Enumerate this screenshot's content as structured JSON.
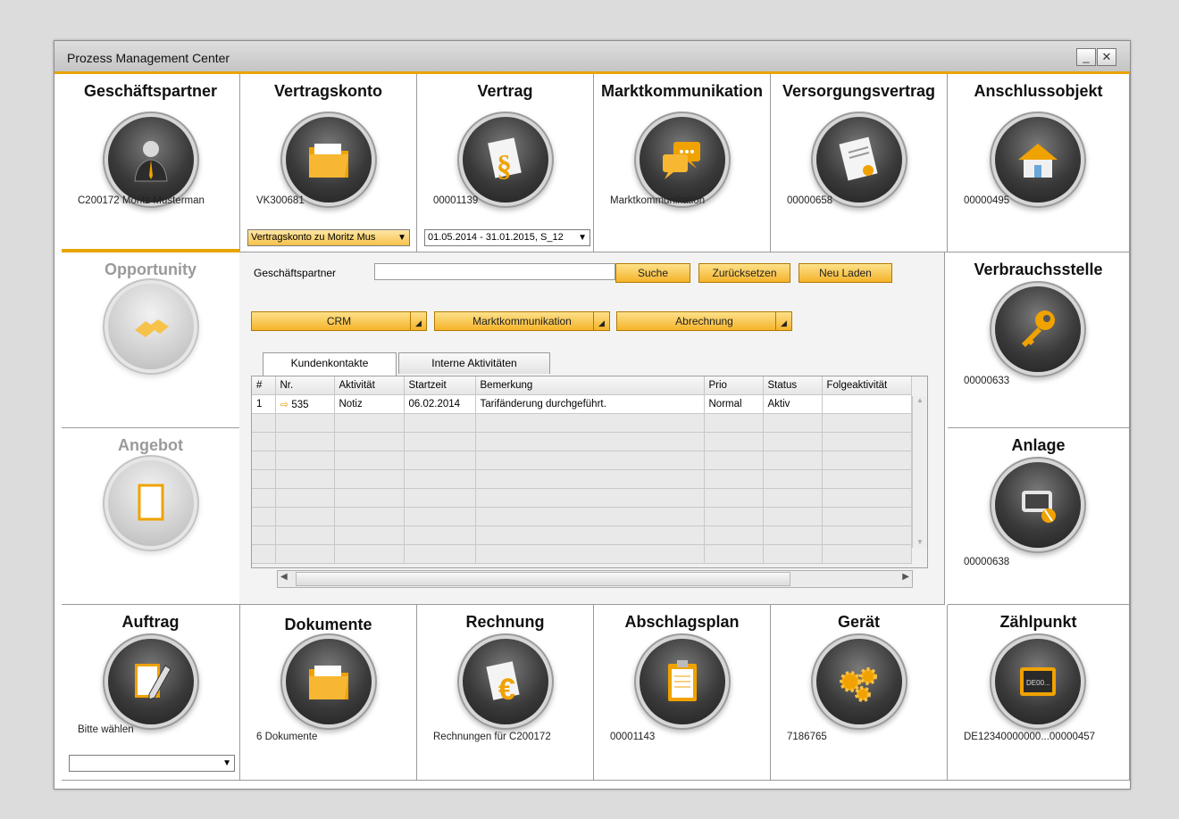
{
  "window": {
    "title": "Prozess Management Center",
    "min_btn": "_",
    "close_btn": "✕"
  },
  "tiles": {
    "geschaeftspartner": {
      "label": "Geschäftspartner",
      "value": "C200172 Moritz Musterman"
    },
    "vertragskonto": {
      "label": "Vertragskonto",
      "value": "VK300681",
      "select": "Vertragskonto zu Moritz Mus"
    },
    "vertrag": {
      "label": "Vertrag",
      "value": "00001139",
      "select": "01.05.2014 - 31.01.2015, S_12"
    },
    "marktkommunikation": {
      "label": "Marktkommunikation",
      "value": "Marktkommunikation"
    },
    "versorgungsvertrag": {
      "label": "Versorgungsvertrag",
      "value": "00000658"
    },
    "anschlussobjekt": {
      "label": "Anschlussobjekt",
      "value": "00000495"
    },
    "opportunity": {
      "label": "Opportunity"
    },
    "angebot": {
      "label": "Angebot"
    },
    "verbrauchsstelle": {
      "label": "Verbrauchsstelle",
      "value": "00000633"
    },
    "anlage": {
      "label": "Anlage",
      "value": "00000638"
    },
    "auftrag": {
      "label": "Auftrag",
      "value": "Bitte wählen"
    },
    "dokumente": {
      "label": "Dokumente",
      "value": "6 Dokumente"
    },
    "rechnung": {
      "label": "Rechnung",
      "value": "Rechnungen für C200172"
    },
    "abschlagsplan": {
      "label": "Abschlagsplan",
      "value": "00001143"
    },
    "geraet": {
      "label": "Gerät",
      "value": "7186765"
    },
    "zaehlpunkt": {
      "label": "Zählpunkt",
      "value": "DE12340000000...00000457",
      "screen_text": "DE00..."
    }
  },
  "center": {
    "search_label": "Geschäftspartner",
    "search_value": "",
    "buttons": {
      "suche": "Suche",
      "zuruecksetzen": "Zurücksetzen",
      "neu_laden": "Neu Laden"
    },
    "menus": {
      "crm": "CRM",
      "marktkommunikation": "Marktkommunikation",
      "abrechnung": "Abrechnung"
    },
    "tabs": [
      "Kundenkontakte",
      "Interne Aktivitäten"
    ],
    "columns": [
      "#",
      "Nr.",
      "Aktivität",
      "Startzeit",
      "Bemerkung",
      "Prio",
      "Status",
      "Folgeaktivität"
    ],
    "rows": [
      {
        "idx": "1",
        "nr": "535",
        "aktivitaet": "Notiz",
        "startzeit": "06.02.2014",
        "bemerkung": "Tarifänderung durchgeführt.",
        "prio": "Normal",
        "status": "Aktiv",
        "folge": ""
      }
    ]
  },
  "colors": {
    "accent": "#e8a400",
    "button": "#f7c24a"
  }
}
